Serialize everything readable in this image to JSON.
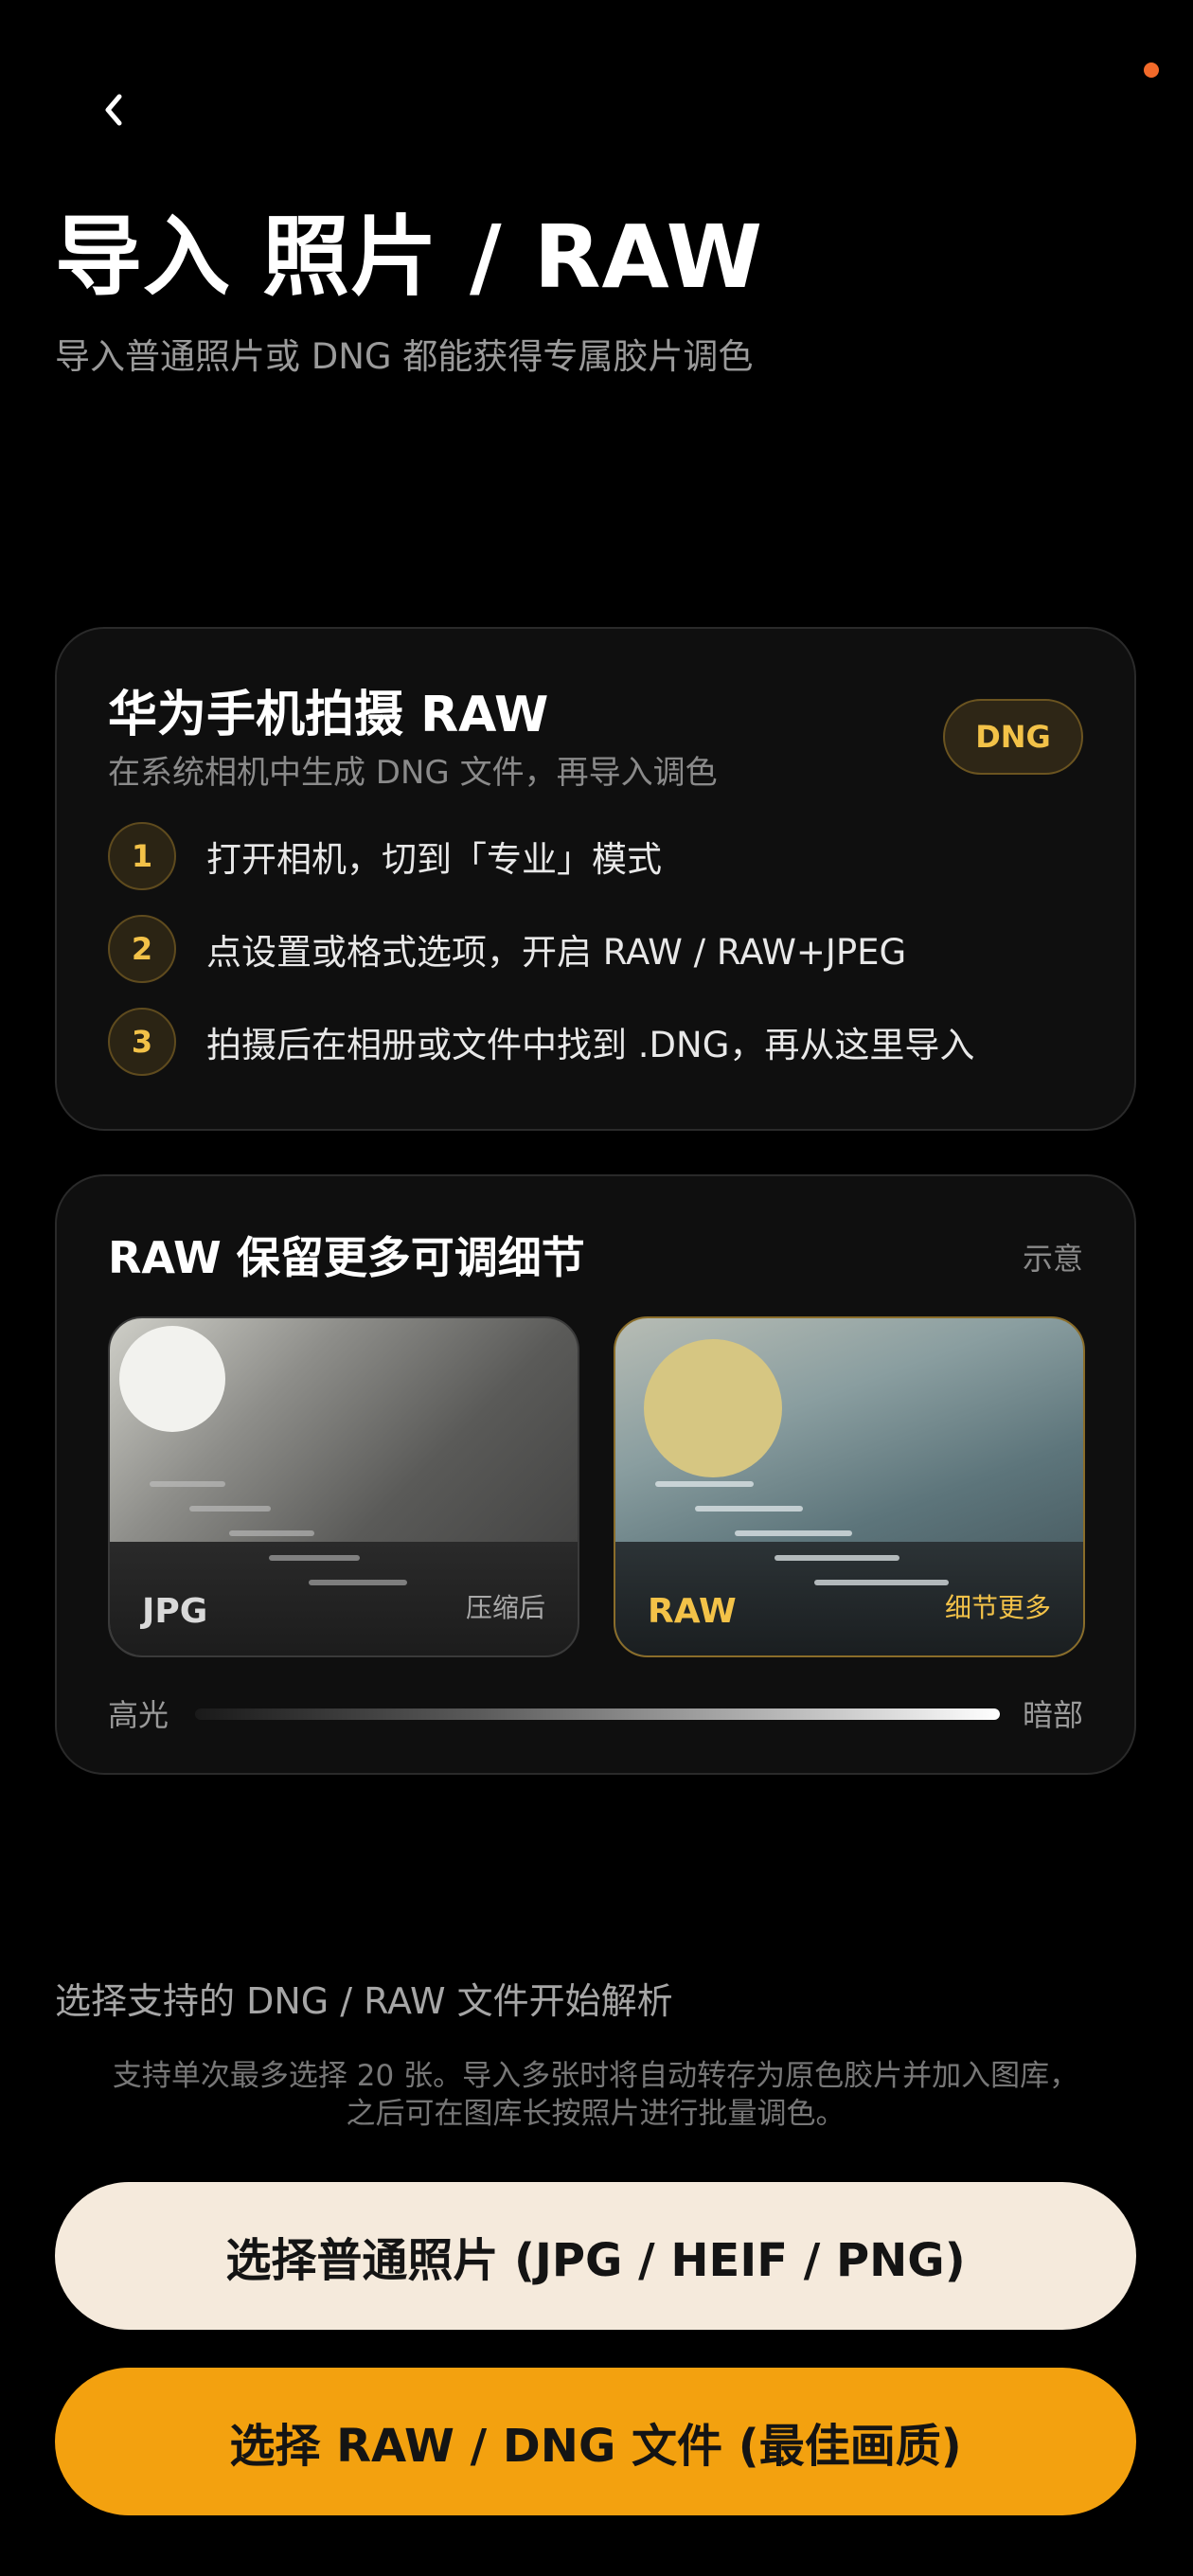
{
  "header": {
    "title": "导入 照片 / RAW",
    "subtitle": "导入普通照片或 DNG 都能获得专属胶片调色",
    "back_icon": "chevron-left-icon",
    "status_dot_color": "#f26a2a"
  },
  "huawei_card": {
    "title": "华为手机拍摄 RAW",
    "subtitle": "在系统相机中生成 DNG 文件，再导入调色",
    "badge": "DNG",
    "steps": [
      {
        "num": "1",
        "text": "打开相机，切到「专业」模式"
      },
      {
        "num": "2",
        "text": "点设置或格式选项，开启 RAW / RAW+JPEG"
      },
      {
        "num": "3",
        "text": "拍摄后在相册或文件中找到 .DNG，再从这里导入"
      }
    ]
  },
  "compare_card": {
    "title": "RAW 保留更多可调细节",
    "hint": "示意",
    "jpg": {
      "label": "JPG",
      "tag": "压缩后"
    },
    "raw": {
      "label": "RAW",
      "tag": "细节更多"
    },
    "range_low": "高光",
    "range_high": "暗部"
  },
  "import": {
    "hint": "选择支持的 DNG / RAW 文件开始解析",
    "note_line1": "支持单次最多选择 20 张。导入多张时将自动转存为原色胶片并加入图库，",
    "note_line2": "之后可在图库长按照片进行批量调色。",
    "normal_button": "选择普通照片 (JPG / HEIF / PNG)",
    "raw_button": "选择 RAW / DNG 文件 (最佳画质)"
  },
  "colors": {
    "accent": "#f3a10f",
    "gold": "#f3c248",
    "cream": "#f5eadc"
  }
}
